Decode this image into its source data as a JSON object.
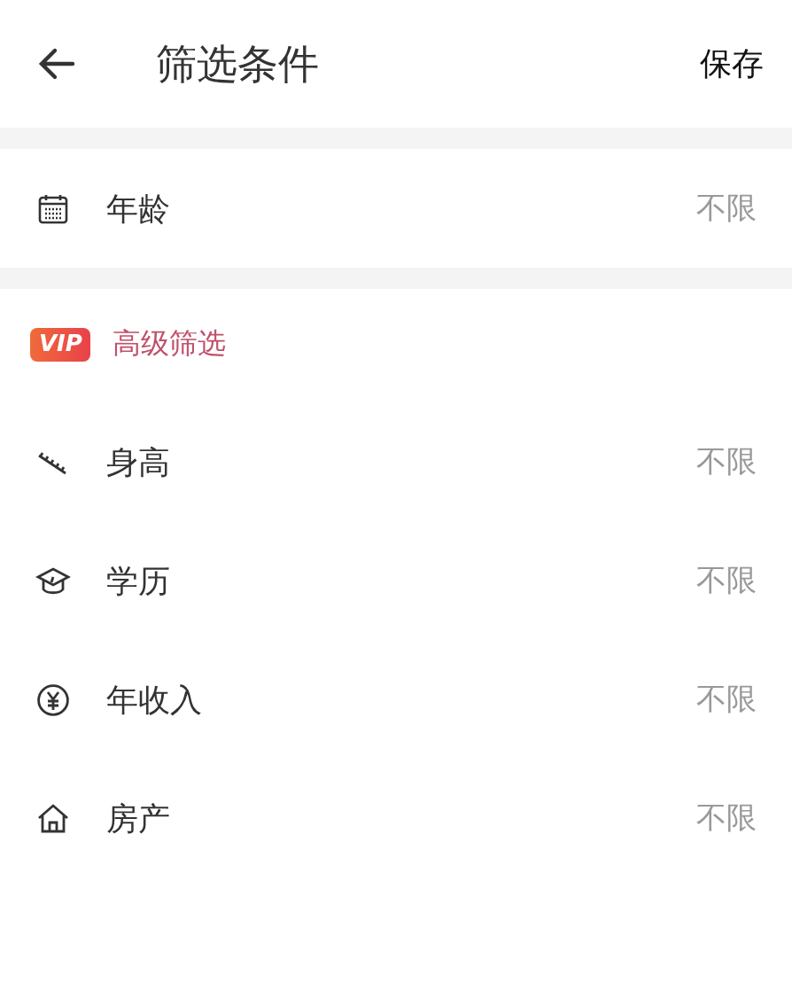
{
  "header": {
    "title": "筛选条件",
    "save": "保存"
  },
  "basic": [
    {
      "kind": "calendar",
      "label": "年龄",
      "value": "不限"
    }
  ],
  "advanced": {
    "badge": "VIP",
    "title": "高级筛选",
    "rows": [
      {
        "kind": "ruler",
        "label": "身高",
        "value": "不限"
      },
      {
        "kind": "cap",
        "label": "学历",
        "value": "不限"
      },
      {
        "kind": "yen",
        "label": "年收入",
        "value": "不限"
      },
      {
        "kind": "house",
        "label": "房产",
        "value": "不限"
      }
    ]
  }
}
